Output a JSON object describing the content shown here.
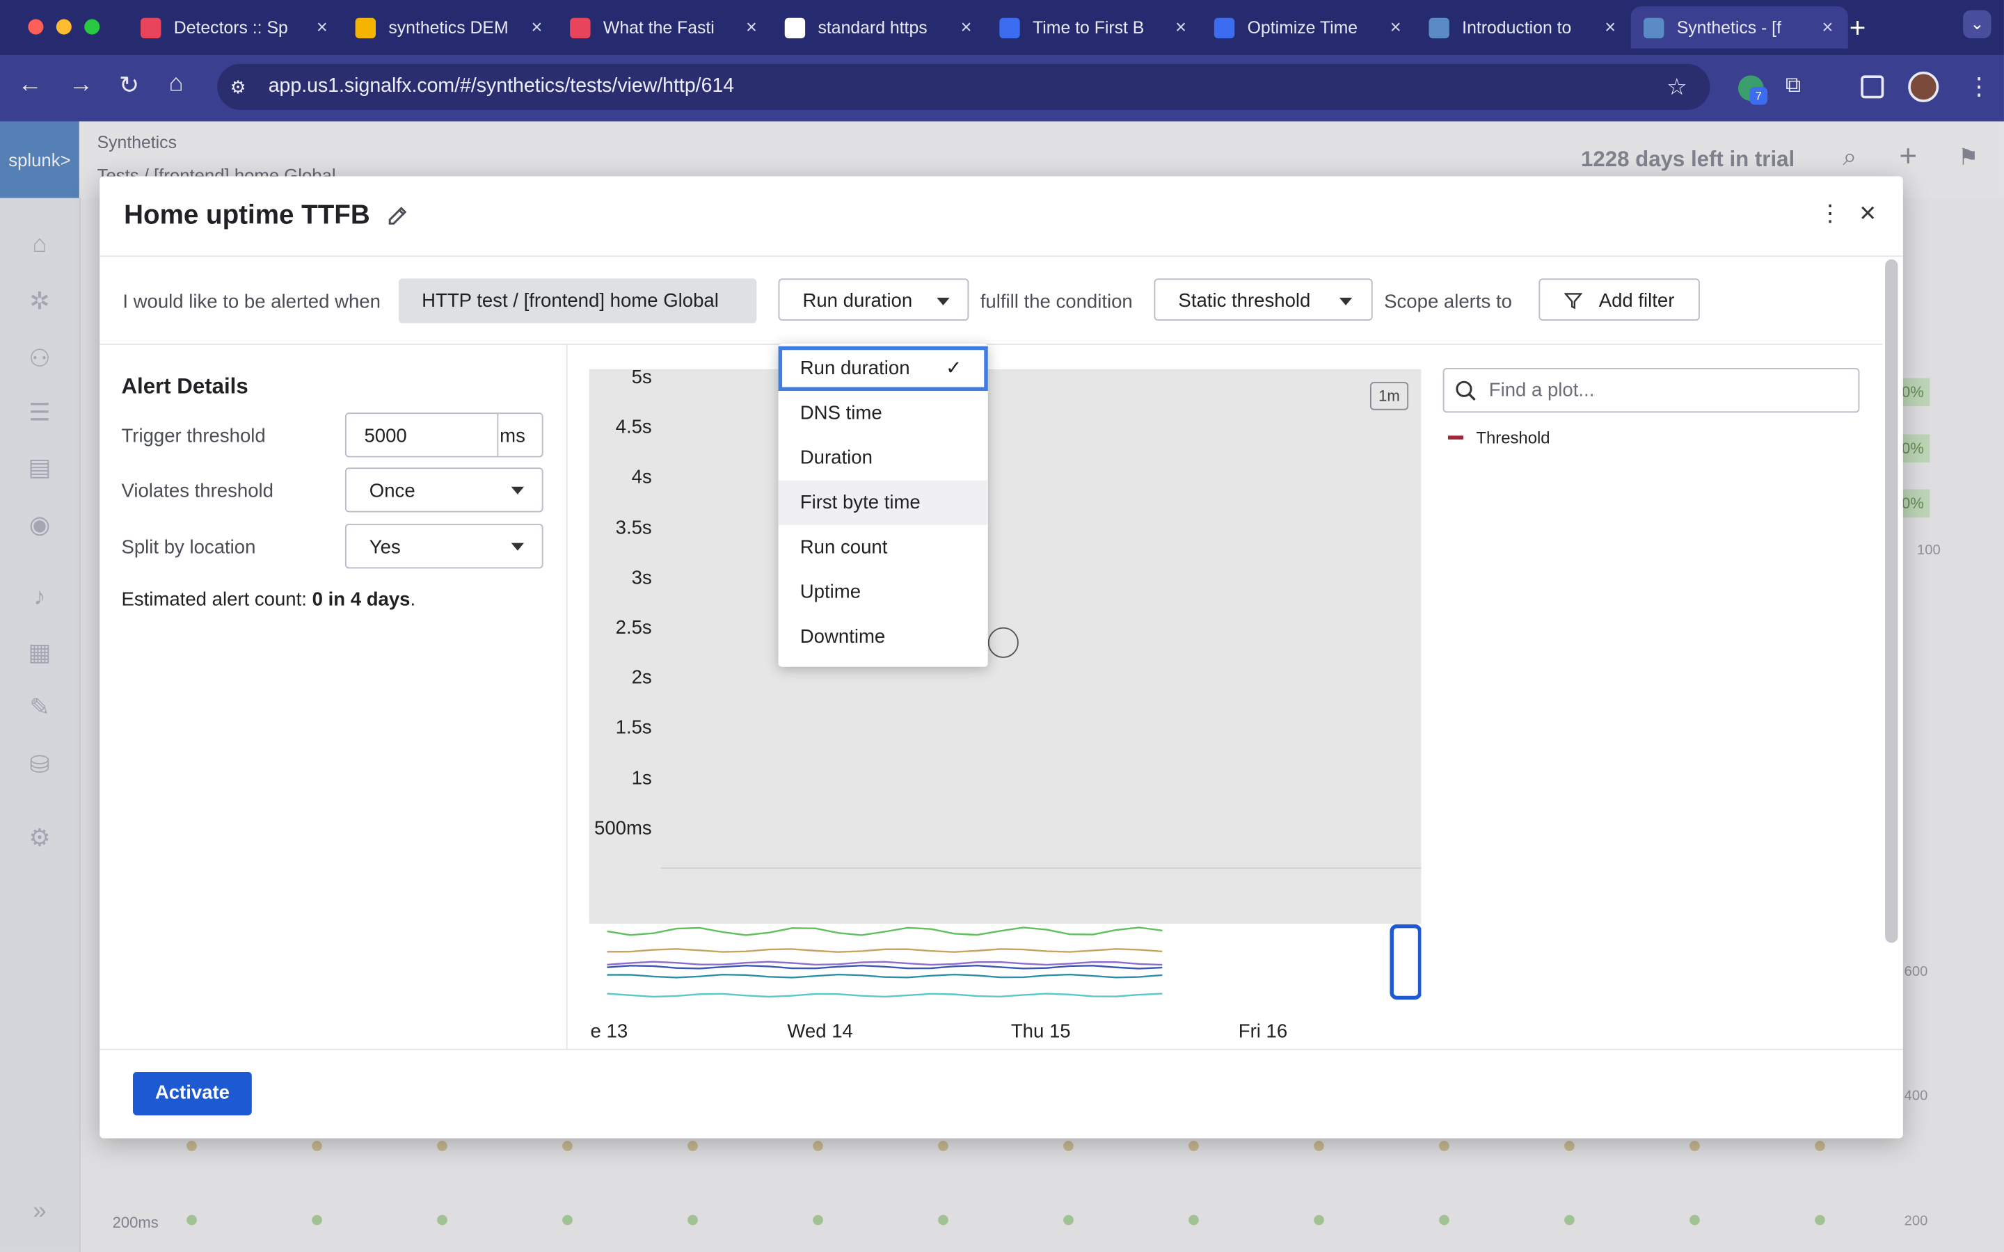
{
  "browser": {
    "tabs": [
      {
        "title": "Detectors :: Sp",
        "active": false,
        "favicon": "splunk-o11y-icon",
        "color": "#e8455c"
      },
      {
        "title": "synthetics DEM",
        "active": false,
        "favicon": "slides-icon",
        "color": "#f4b400"
      },
      {
        "title": "What the Fasti",
        "active": false,
        "favicon": "splunk-o11y-icon",
        "color": "#e8455c"
      },
      {
        "title": "standard https",
        "active": false,
        "favicon": "google-icon",
        "color": "#ffffff"
      },
      {
        "title": "Time to First B",
        "active": false,
        "favicon": "docs-icon",
        "color": "#3c6cf0"
      },
      {
        "title": "Optimize Time",
        "active": false,
        "favicon": "docs-icon",
        "color": "#3c6cf0"
      },
      {
        "title": "Introduction to",
        "active": false,
        "favicon": "splunk-icon",
        "color": "#5a8bc4"
      },
      {
        "title": "Synthetics - [f",
        "active": true,
        "favicon": "splunk-icon",
        "color": "#5a8bc4"
      }
    ],
    "url": "app.us1.signalfx.com/#/synthetics/tests/view/http/614",
    "extensions_badge": "7"
  },
  "app": {
    "logo": "splunk>",
    "section": "Synthetics",
    "breadcrumb": "Tests  /  [frontend] home Global",
    "trial": "1228 days left in trial",
    "bg_tick_200ms": "200ms",
    "bg_right_ticks": [
      "100",
      "600",
      "400",
      "200"
    ],
    "bg_badges": [
      "0%",
      "0%",
      "0%"
    ]
  },
  "modal": {
    "title": "Home uptime TTFB",
    "condition": {
      "prefix": "I would like to be alerted when",
      "test_chip": "HTTP test  /  [frontend] home Global",
      "metric": "Run duration",
      "fulfill": "fulfill the condition",
      "condition": "Static threshold",
      "scope": "Scope alerts to",
      "add_filter": "Add filter"
    },
    "alert_details": {
      "heading": "Alert Details",
      "trigger_label": "Trigger threshold",
      "trigger_value": "5000",
      "trigger_unit": "ms",
      "violates_label": "Violates threshold",
      "violates_value": "Once",
      "split_label": "Split by location",
      "split_value": "Yes",
      "estimate_prefix": "Estimated alert count:",
      "estimate_value": "0 in 4 days",
      "estimate_suffix": "."
    },
    "metric_options": [
      "Run duration",
      "DNS time",
      "Duration",
      "First byte time",
      "Run count",
      "Uptime",
      "Downtime"
    ],
    "metric_selected": "Run duration",
    "metric_hovered": "First byte time",
    "plot_search_placeholder": "Find a plot...",
    "legend": [
      {
        "name": "Threshold",
        "color": "#a3263a"
      }
    ],
    "resolution": "1m",
    "activate": "Activate"
  },
  "chart_data": {
    "type": "line",
    "y_ticks": [
      "5s",
      "4.5s",
      "4s",
      "3.5s",
      "3s",
      "2.5s",
      "2s",
      "1.5s",
      "1s",
      "500ms"
    ],
    "x_ticks": [
      "e 13",
      "Wed 14",
      "Thu 15",
      "Fri 16"
    ],
    "series": [
      {
        "name": "Threshold",
        "color": "#a3263a",
        "values": []
      }
    ],
    "overview_series_colors": [
      "#5fc05c",
      "#c9a25f",
      "#8d6bd0",
      "#3a57b5",
      "#2f8fa8",
      "#5ac8c8"
    ]
  }
}
